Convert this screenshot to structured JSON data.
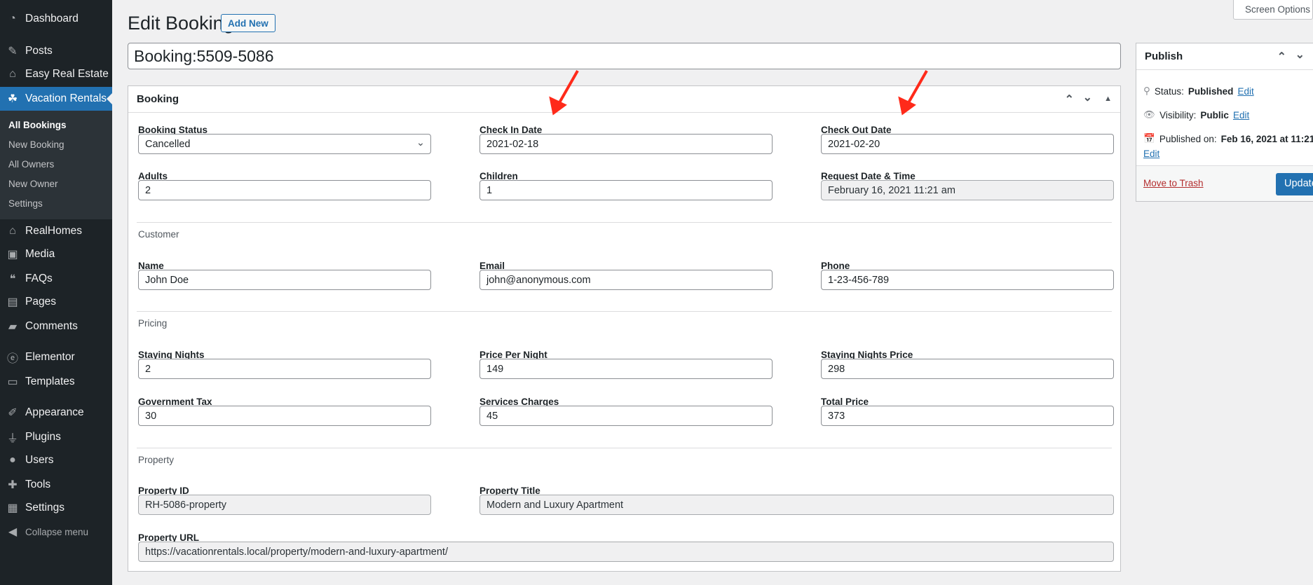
{
  "sidebar": {
    "items": [
      {
        "label": "Dashboard",
        "icon": "dashboard-icon"
      },
      {
        "label": "Posts",
        "icon": "pin-icon"
      },
      {
        "label": "Easy Real Estate",
        "icon": "house-check-icon"
      },
      {
        "label": "Vacation Rentals",
        "icon": "palm-tree-icon",
        "active": true
      },
      {
        "label": "RealHomes",
        "icon": "house-icon"
      },
      {
        "label": "Media",
        "icon": "media-icon"
      },
      {
        "label": "FAQs",
        "icon": "comments-icon"
      },
      {
        "label": "Pages",
        "icon": "pages-icon"
      },
      {
        "label": "Comments",
        "icon": "comment-icon"
      },
      {
        "label": "Elementor",
        "icon": "elementor-icon"
      },
      {
        "label": "Templates",
        "icon": "folder-icon"
      },
      {
        "label": "Appearance",
        "icon": "brush-icon"
      },
      {
        "label": "Plugins",
        "icon": "plug-icon"
      },
      {
        "label": "Users",
        "icon": "user-icon"
      },
      {
        "label": "Tools",
        "icon": "wrench-icon"
      },
      {
        "label": "Settings",
        "icon": "settings-icon"
      },
      {
        "label": "Collapse menu",
        "icon": "collapse-icon"
      }
    ],
    "submenu": [
      "All Bookings",
      "New Booking",
      "All Owners",
      "New Owner",
      "Settings"
    ]
  },
  "header": {
    "title": "Edit Booking",
    "add_new": "Add New",
    "screen_options": "Screen Options"
  },
  "post_title": "Booking:5509-5086",
  "booking": {
    "title": "Booking",
    "fields": {
      "booking_status": {
        "label": "Booking Status",
        "value": "Cancelled"
      },
      "check_in": {
        "label": "Check In Date",
        "value": "2021-02-18"
      },
      "check_out": {
        "label": "Check Out Date",
        "value": "2021-02-20"
      },
      "adults": {
        "label": "Adults",
        "value": "2"
      },
      "children": {
        "label": "Children",
        "value": "1"
      },
      "request_date": {
        "label": "Request Date & Time",
        "value": "February 16, 2021 11:21 am"
      },
      "name": {
        "label": "Name",
        "value": "John Doe"
      },
      "email": {
        "label": "Email",
        "value": "john@anonymous.com"
      },
      "phone": {
        "label": "Phone",
        "value": "1-23-456-789"
      },
      "staying_nights": {
        "label": "Staying Nights",
        "value": "2"
      },
      "price_per_night": {
        "label": "Price Per Night",
        "value": "149"
      },
      "staying_nights_price": {
        "label": "Staying Nights Price",
        "value": "298"
      },
      "government_tax": {
        "label": "Government Tax",
        "value": "30"
      },
      "services_charges": {
        "label": "Services Charges",
        "value": "45"
      },
      "total_price": {
        "label": "Total Price",
        "value": "373"
      },
      "property_id": {
        "label": "Property ID",
        "value": "RH-5086-property"
      },
      "property_title": {
        "label": "Property Title",
        "value": "Modern and Luxury Apartment"
      },
      "property_url": {
        "label": "Property URL",
        "value": "https://vacationrentals.local/property/modern-and-luxury-apartment/"
      }
    },
    "sections": {
      "customer": "Customer",
      "pricing": "Pricing",
      "property": "Property"
    }
  },
  "publish": {
    "title": "Publish",
    "status_label": "Status:",
    "status": "Published",
    "visibility_label": "Visibility:",
    "visibility": "Public",
    "published_label": "Published on:",
    "published": "Feb 16, 2021 at 11:21",
    "edit": "Edit",
    "trash": "Move to Trash",
    "update": "Update"
  },
  "colors": {
    "accent": "#2271b1",
    "sidebar": "#1d2327",
    "annotation_arrow": "#ff2a1a",
    "trash": "#b32d2e"
  }
}
